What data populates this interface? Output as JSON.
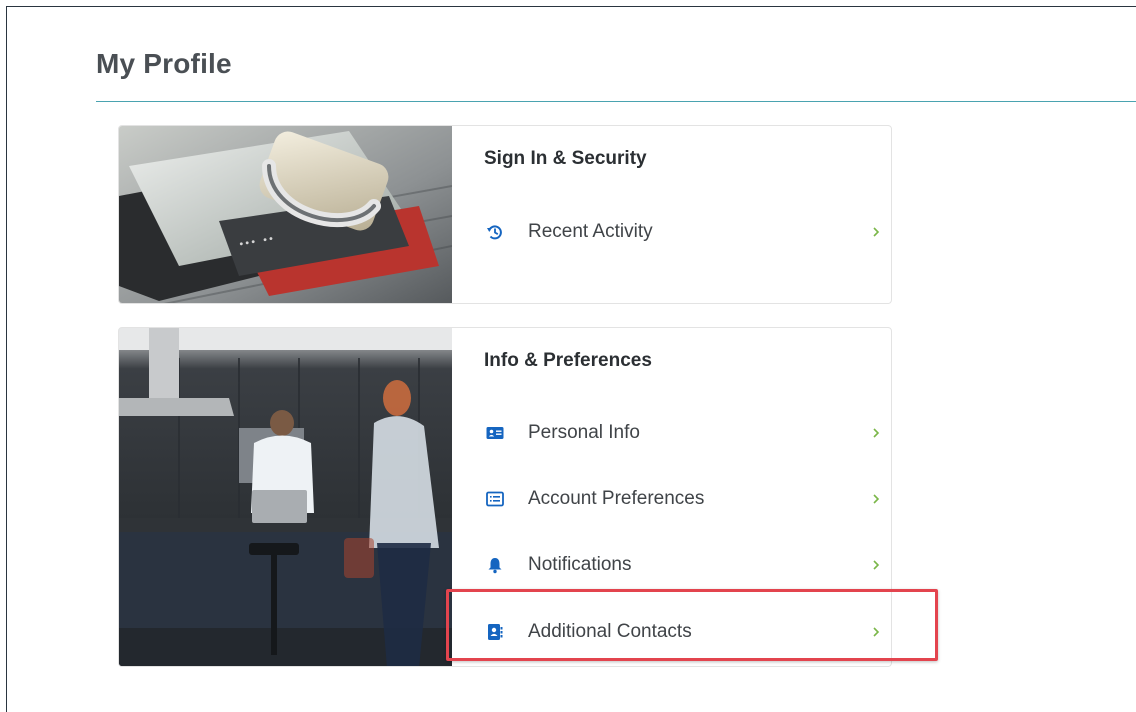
{
  "page": {
    "title": "My Profile"
  },
  "sections": [
    {
      "title": "Sign In & Security",
      "items": [
        {
          "label": "Recent Activity",
          "icon": "history-icon"
        }
      ]
    },
    {
      "title": "Info & Preferences",
      "items": [
        {
          "label": "Personal Info",
          "icon": "id-card-icon"
        },
        {
          "label": "Account Preferences",
          "icon": "list-icon"
        },
        {
          "label": "Notifications",
          "icon": "bell-icon"
        },
        {
          "label": "Additional Contacts",
          "icon": "contact-book-icon"
        }
      ]
    }
  ],
  "colors": {
    "title_rule": "#4aa3b0",
    "icon_blue": "#1565c0",
    "chevron_green": "#7ab648",
    "highlight_red": "#e3444e"
  }
}
